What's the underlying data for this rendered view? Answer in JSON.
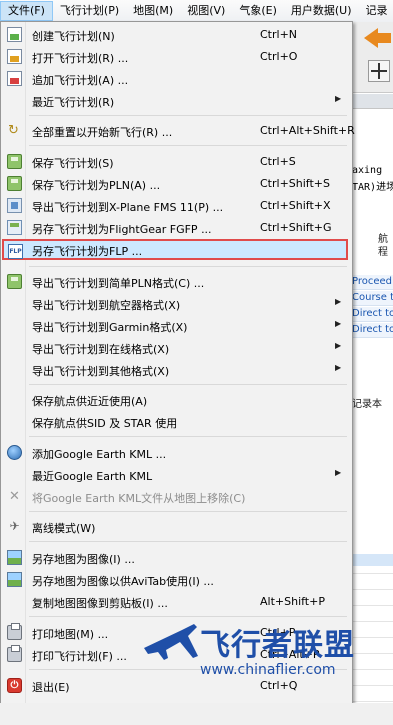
{
  "menubar": {
    "items": [
      "文件(F)",
      "飞行计划(P)",
      "地图(M)",
      "视图(V)",
      "气象(E)",
      "用户数据(U)",
      "记录"
    ]
  },
  "background": {
    "mono_line1": "axing",
    "mono_line2": "TAR)进场",
    "side_text1": "航",
    "side_text2": "程",
    "links": [
      "Proceed",
      "Course to",
      "Direct to",
      "Direct to"
    ],
    "tab_label": "记录本"
  },
  "file_menu": {
    "items": [
      {
        "label": "创建飞行计划(N)",
        "shortcut": "Ctrl+N",
        "icon": "new-flight-plan-icon"
      },
      {
        "label": "打开飞行计划(R) ...",
        "shortcut": "Ctrl+O",
        "icon": "open-flight-plan-icon"
      },
      {
        "label": "追加飞行计划(A) ...",
        "shortcut": "",
        "icon": "append-flight-plan-icon"
      },
      {
        "label": "最近飞行计划(R)",
        "shortcut": "",
        "icon": "",
        "submenu": true
      },
      {
        "label": "全部重置以开始新飞行(R) ...",
        "shortcut": "Ctrl+Alt+Shift+R",
        "icon": "reset-icon"
      },
      {
        "label": "保存飞行计划(S)",
        "shortcut": "Ctrl+S",
        "icon": "save-icon"
      },
      {
        "label": "保存飞行计划为PLN(A) ...",
        "shortcut": "Ctrl+Shift+S",
        "icon": "save-as-pln-icon"
      },
      {
        "label": "导出飞行计划到X-Plane FMS 11(P) ...",
        "shortcut": "Ctrl+Shift+X",
        "icon": "export-xplane-icon"
      },
      {
        "label": "另存飞行计划为FlightGear FGFP ...",
        "shortcut": "Ctrl+Shift+G",
        "icon": "save-fgfp-icon"
      },
      {
        "label": "另存飞行计划为FLP ...",
        "shortcut": "",
        "icon": "save-flp-icon"
      },
      {
        "label": "导出飞行计划到简单PLN格式(C) ...",
        "shortcut": "",
        "icon": "export-simple-pln-icon"
      },
      {
        "label": "导出飞行计划到航空器格式(X)",
        "shortcut": "",
        "icon": "",
        "submenu": true
      },
      {
        "label": "导出飞行计划到Garmin格式(X)",
        "shortcut": "",
        "icon": "",
        "submenu": true
      },
      {
        "label": "导出飞行计划到在线格式(X)",
        "shortcut": "",
        "icon": "",
        "submenu": true
      },
      {
        "label": "导出飞行计划到其他格式(X)",
        "shortcut": "",
        "icon": "",
        "submenu": true
      },
      {
        "label": "保存航点供近近使用(A)",
        "shortcut": "",
        "icon": ""
      },
      {
        "label": "保存航点供SID 及 STAR 使用",
        "shortcut": "",
        "icon": ""
      },
      {
        "label": "添加Google Earth KML ...",
        "shortcut": "",
        "icon": "google-earth-icon"
      },
      {
        "label": "最近Google Earth KML",
        "shortcut": "",
        "icon": "",
        "submenu": true
      },
      {
        "label": "将Google Earth KML文件从地图上移除(C)",
        "shortcut": "",
        "icon": "remove-kml-icon",
        "disabled": true
      },
      {
        "label": "离线模式(W)",
        "shortcut": "",
        "icon": "offline-mode-icon"
      },
      {
        "label": "另存地图为图像(I) ...",
        "shortcut": "",
        "icon": "save-map-image-icon"
      },
      {
        "label": "另存地图为图像以供AviTab使用(I) ...",
        "shortcut": "",
        "icon": "save-avitab-image-icon"
      },
      {
        "label": "复制地图图像到剪贴板(I) ...",
        "shortcut": "Alt+Shift+P",
        "icon": ""
      },
      {
        "label": "打印地图(M) ...",
        "shortcut": "Ctrl+P",
        "icon": "print-map-icon"
      },
      {
        "label": "打印飞行计划(F) ...",
        "shortcut": "Ctrl+Alt+P",
        "icon": "print-flight-plan-icon"
      },
      {
        "label": "退出(E)",
        "shortcut": "Ctrl+Q",
        "icon": "exit-icon"
      }
    ]
  },
  "watermark": {
    "title": "飞行者联盟",
    "url": "www.chinaflier.com"
  },
  "colors": {
    "highlight_bg": "#cce8ff",
    "highlight_border": "#e04b4b",
    "watermark": "#1f4fa8"
  }
}
